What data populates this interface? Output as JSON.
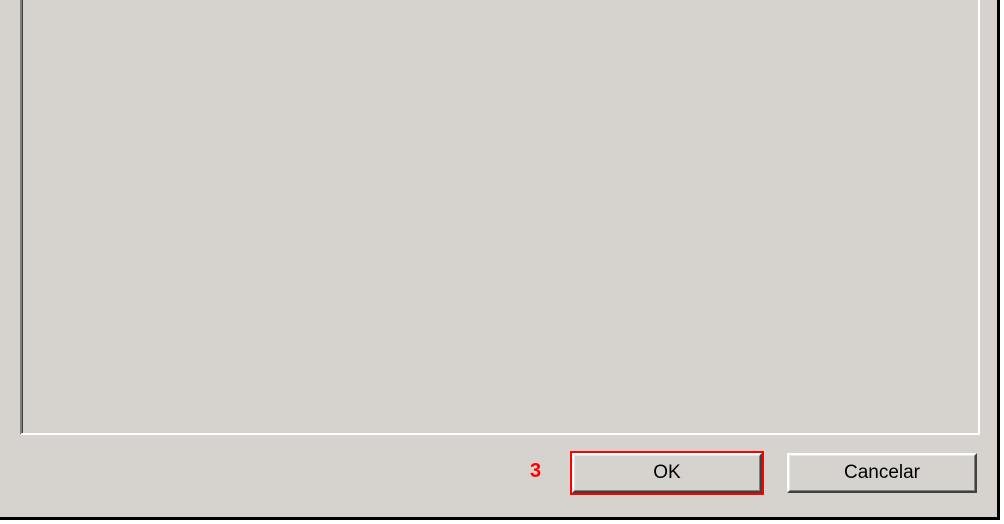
{
  "annotation": {
    "number": "3"
  },
  "buttons": {
    "ok_label": "OK",
    "cancel_label": "Cancelar"
  }
}
